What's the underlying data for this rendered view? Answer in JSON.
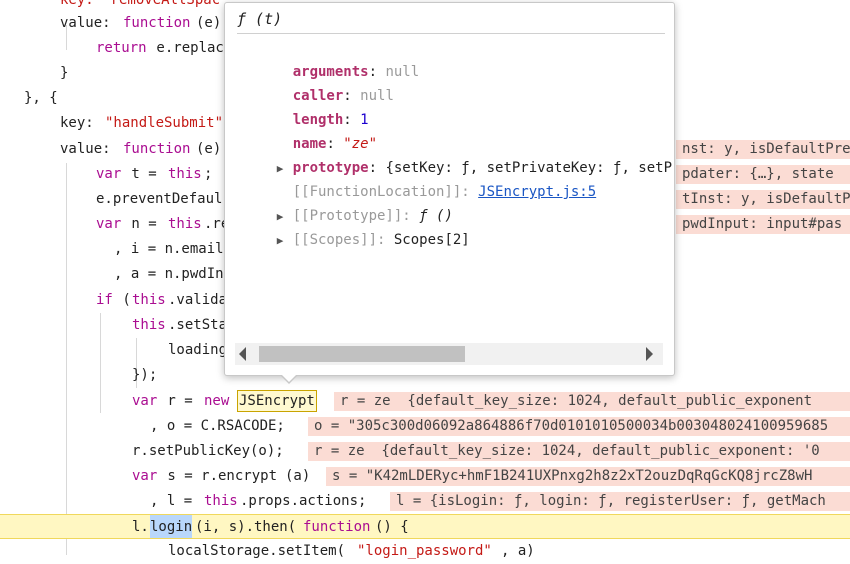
{
  "code": {
    "l0": "key: \"removeAllSpac",
    "l1a": "value: ",
    "l1b": "function",
    "l1c": "(e)",
    "l2a": "return",
    "l2b": " e.replac",
    "l3": "}",
    "l4": "}, {",
    "l5a": "key: ",
    "l5b": "\"handleSubmit\"",
    "l6a": "value: ",
    "l6b": "function",
    "l6c": "(e)",
    "l7a": "var",
    "l7b": " t = ",
    "l7c": "this",
    "l7d": ";",
    "l8": "e.preventDefaul",
    "l9a": "var",
    "l9b": " n = ",
    "l9c": "this",
    "l9d": ".re",
    "l10": ", i = n.email",
    "l11": ", a = n.pwdIn",
    "l12a": "if",
    "l12b": " (",
    "l12c": "this",
    "l12d": ".valida",
    "l13a": "this",
    "l13b": ".setSta",
    "l14": "loading",
    "l15": "});",
    "l16a": "var",
    "l16b": " r = ",
    "l16c": "new",
    "l16d": "JSEncrypt",
    "l17": ", o = C.RSACODE;",
    "l18": "r.setPublicKey(o);",
    "l19a": "var",
    "l19b": " s = r.encrypt",
    "l19c": "(a)",
    "l20a": ", l = ",
    "l20b": "this",
    "l20c": ".props.actions;",
    "l21a": "l.",
    "l21b": "login",
    "l21c": "(i, s).then(",
    "l21d": "function",
    "l21e": "() {",
    "l22a": "localStorage.setItem(",
    "l22b": "\"login_password\"",
    "l22c": ", a)"
  },
  "inline_values": {
    "v6": "nst: y, isDefaultPrev",
    "v7": "pdater: {…}, state",
    "v8": "tInst: y, isDefaultP",
    "v9": "pwdInput: input#pas",
    "v16": "r = ze  {default_key_size: 1024, default_public_exponent",
    "v17": "o = \"305c300d06092a864886f70d0101010500034b003048024100959685",
    "v18": "r = ze  {default_key_size: 1024, default_public_exponent: '0",
    "v19": "s = \"K42mLDERyc+hmF1B241UXPnxg2h8z2xT2ouzDqRqGcKQ8jrcZ8wH",
    "v20": "l = {isLogin: ƒ, login: ƒ, registerUser: ƒ, getMach"
  },
  "popover": {
    "header": "ƒ (t)",
    "arguments_key": "arguments",
    "arguments_val": "null",
    "caller_key": "caller",
    "caller_val": "null",
    "length_key": "length",
    "length_val": "1",
    "name_key": "name",
    "name_val": "\"ze\"",
    "prototype_key": "prototype",
    "prototype_val": "{setKey: ƒ, setPrivateKey: ƒ, setP",
    "location_key": "[[FunctionLocation]]",
    "location_val": "JSEncrypt.js:5",
    "proto_key": "[[Prototype]]",
    "proto_val": "ƒ ()",
    "scopes_key": "[[Scopes]]",
    "scopes_val": "Scopes[2]"
  }
}
